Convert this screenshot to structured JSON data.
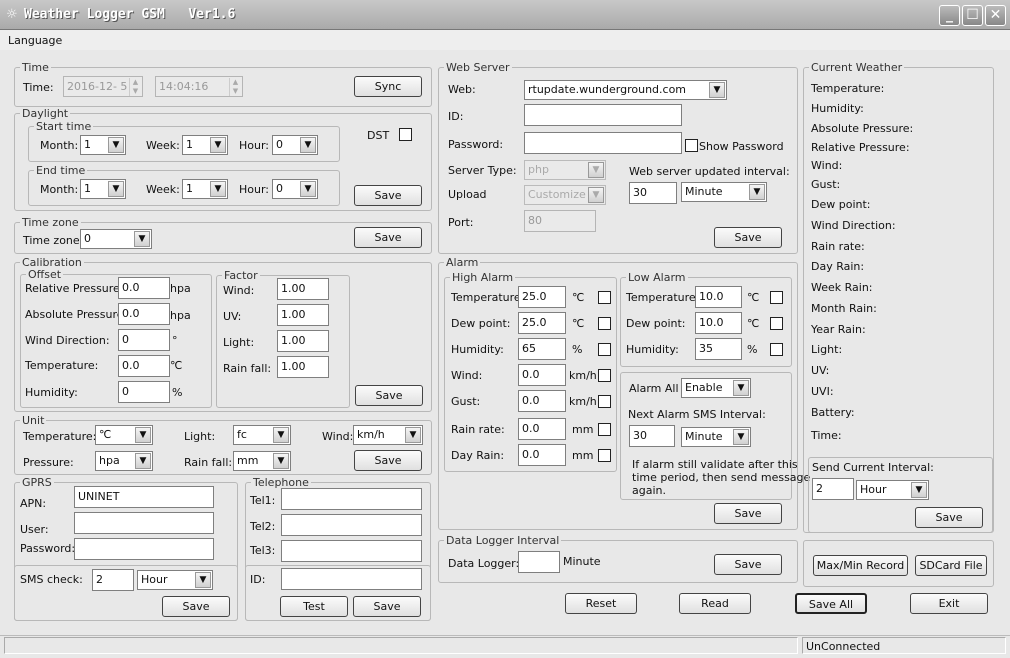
{
  "window": {
    "title": "Weather Logger GSM   Ver1.6",
    "min": "_",
    "max": "☐",
    "close": "✕",
    "app_icon": "☼"
  },
  "menu": {
    "language": "Language"
  },
  "time": {
    "group": "Time",
    "label": "Time:",
    "date": "2016-12- 5",
    "clock": "14:04:16",
    "sync": "Sync"
  },
  "daylight": {
    "group": "Daylight",
    "start_group": "Start time",
    "end_group": "End time",
    "month": "Month:",
    "week": "Week:",
    "hour": "Hour:",
    "start_month": "1",
    "start_week": "1",
    "start_hour": "0",
    "end_month": "1",
    "end_week": "1",
    "end_hour": "0",
    "dst": "DST",
    "save": "Save"
  },
  "timezone": {
    "group": "Time zone",
    "label": "Time zone:",
    "value": "0",
    "save": "Save"
  },
  "calibration": {
    "group": "Calibration",
    "offset_group": "Offset",
    "factor_group": "Factor",
    "rel_pressure": "Relative Pressure:",
    "rel_pressure_val": "0.0",
    "abs_pressure": "Absolute Pressure:",
    "abs_pressure_val": "0.0",
    "unit_hpa": "hpa",
    "wind_dir": "Wind Direction:",
    "wind_dir_val": "0",
    "unit_deg": "°",
    "temperature": "Temperature:",
    "temperature_val": "0.0",
    "unit_c": "℃",
    "humidity": "Humidity:",
    "humidity_val": "0",
    "unit_pct": "%",
    "wind": "Wind:",
    "wind_val": "1.00",
    "uv": "UV:",
    "uv_val": "1.00",
    "light": "Light:",
    "light_val": "1.00",
    "rainfall": "Rain fall:",
    "rainfall_val": "1.00",
    "save": "Save"
  },
  "unit": {
    "group": "Unit",
    "temperature": "Temperature:",
    "temperature_val": "℃",
    "light": "Light:",
    "light_val": "fc",
    "wind": "Wind:",
    "wind_val": "km/h",
    "pressure": "Pressure:",
    "pressure_val": "hpa",
    "rainfall": "Rain fall:",
    "rainfall_val": "mm",
    "save": "Save"
  },
  "gprs": {
    "group": "GPRS",
    "apn": "APN:",
    "apn_val": "UNINET",
    "user": "User:",
    "user_val": "",
    "password": "Password:",
    "password_val": "",
    "sms": "SMS check:",
    "sms_val": "2",
    "sms_unit": "Hour",
    "save": "Save"
  },
  "telephone": {
    "group": "Telephone",
    "tel1": "Tel1:",
    "tel2": "Tel2:",
    "tel3": "Tel3:",
    "id": "ID:",
    "test": "Test",
    "save": "Save"
  },
  "webserver": {
    "group": "Web Server",
    "web": "Web:",
    "web_val": "rtupdate.wunderground.com",
    "id": "ID:",
    "password": "Password:",
    "show_password": "Show Password",
    "server_type": "Server Type:",
    "server_type_val": "php",
    "upload": "Upload",
    "upload_val": "Customize",
    "port": "Port:",
    "port_val": "80",
    "interval_label": "Web server updated interval:",
    "interval_val": "30",
    "interval_unit": "Minute",
    "save": "Save"
  },
  "alarm": {
    "group": "Alarm",
    "high_group": "High Alarm",
    "low_group": "Low Alarm",
    "high": [
      {
        "label": "Temperature:",
        "value": "25.0",
        "unit": "℃"
      },
      {
        "label": "Dew point:",
        "value": "25.0",
        "unit": "℃"
      },
      {
        "label": "Humidity:",
        "value": "65",
        "unit": "%"
      },
      {
        "label": "Wind:",
        "value": "0.0",
        "unit": "km/h"
      },
      {
        "label": "Gust:",
        "value": "0.0",
        "unit": "km/h"
      },
      {
        "label": "Rain rate:",
        "value": "0.0",
        "unit": "mm"
      },
      {
        "label": "Day Rain:",
        "value": "0.0",
        "unit": "mm"
      }
    ],
    "low": [
      {
        "label": "Temperature:",
        "value": "10.0",
        "unit": "℃"
      },
      {
        "label": "Dew point:",
        "value": "10.0",
        "unit": "℃"
      },
      {
        "label": "Humidity:",
        "value": "35",
        "unit": "%"
      }
    ],
    "alarm_all": "Alarm All",
    "alarm_all_val": "Enable",
    "next_sms": "Next Alarm SMS Interval:",
    "next_sms_val": "30",
    "next_sms_unit": "Minute",
    "note_1": "If alarm still validate after this",
    "note_2": "time period, then send message",
    "note_3": "again.",
    "save": "Save"
  },
  "datalogger": {
    "group": "Data Logger Interval",
    "label": "Data Logger:",
    "value": "",
    "unit": "Minute",
    "save": "Save"
  },
  "bottom": {
    "reset": "Reset",
    "read": "Read",
    "save_all": "Save All",
    "exit": "Exit"
  },
  "current": {
    "group": "Current Weather",
    "items": [
      "Temperature:",
      "Humidity:",
      "Absolute Pressure:",
      "Relative Pressure:",
      "Wind:",
      "Gust:",
      "Dew point:",
      "Wind Direction:",
      "Rain rate:",
      "Day Rain:",
      "Week Rain:",
      "Month Rain:",
      "Year Rain:",
      "Light:",
      "UV:",
      "UVI:",
      "Battery:",
      "Time:"
    ],
    "send_interval": "Send Current Interval:",
    "send_interval_val": "2",
    "send_interval_unit": "Hour",
    "save": "Save",
    "maxmin": "Max/Min Record",
    "sdcard": "SDCard File"
  },
  "status": {
    "connection": "UnConnected"
  }
}
